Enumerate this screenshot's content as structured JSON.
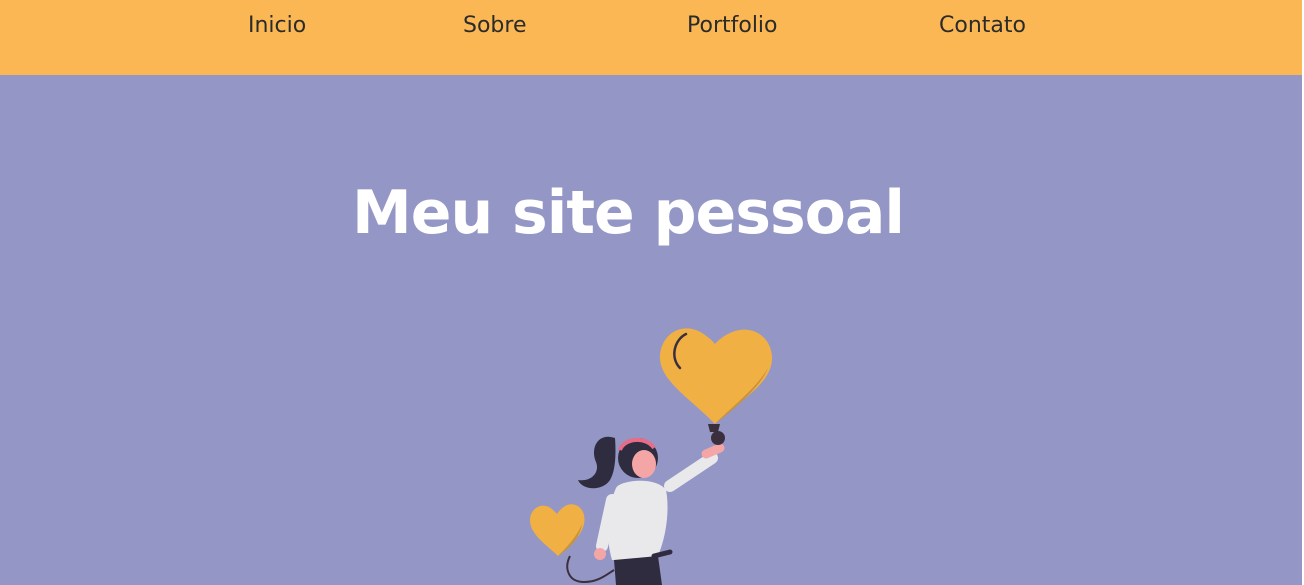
{
  "nav": {
    "items": [
      {
        "label": "Inicio"
      },
      {
        "label": "Sobre"
      },
      {
        "label": "Portfolio"
      },
      {
        "label": "Contato"
      }
    ]
  },
  "hero": {
    "title": "Meu site pessoal",
    "illustration": "woman-holding-heart-balloons"
  },
  "colors": {
    "nav_background": "#fab754",
    "hero_background": "#9496c5",
    "balloon": "#f0b043",
    "title_text": "#ffffff",
    "nav_text": "#2b2b2b"
  }
}
